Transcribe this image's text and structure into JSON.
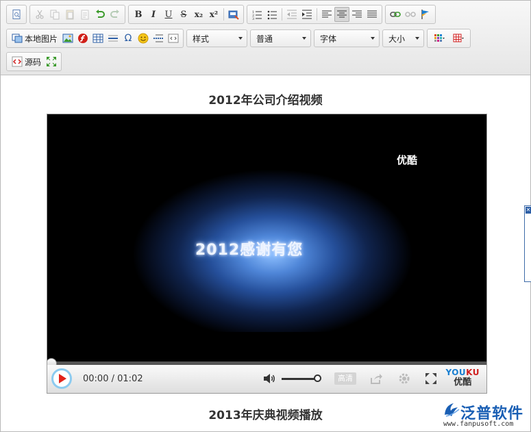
{
  "toolbar": {
    "bold_label": "B",
    "italic_label": "I",
    "underline_label": "U",
    "strike_label": "S",
    "subscript_label": "x₂",
    "superscript_label": "x²",
    "local_image_label": "本地图片",
    "source_label": "源码",
    "style_combo": "样式",
    "format_combo": "普通",
    "font_combo": "字体",
    "size_combo": "大小",
    "omega_label": "Ω"
  },
  "content": {
    "heading1": "2012年公司介绍视频",
    "heading2": "2013年庆典视频播放"
  },
  "player": {
    "video_caption": "2012感谢有您",
    "watermark": "优酷",
    "current_time": "00:00",
    "duration": "01:02",
    "time_separator": " / ",
    "quality_label": "高清",
    "brand_top": "YOU",
    "brand_top_accent": "KU",
    "brand_bottom": "优酷",
    "progress": 0.0,
    "volume": 1.0,
    "progress_color": "#e00000",
    "play_color": "#e2231a"
  },
  "site_logo": {
    "name": "泛普软件",
    "url": "www.fanpusoft.com",
    "color": "#1a5fb4"
  },
  "side_panel": {
    "close_label": "✕"
  }
}
